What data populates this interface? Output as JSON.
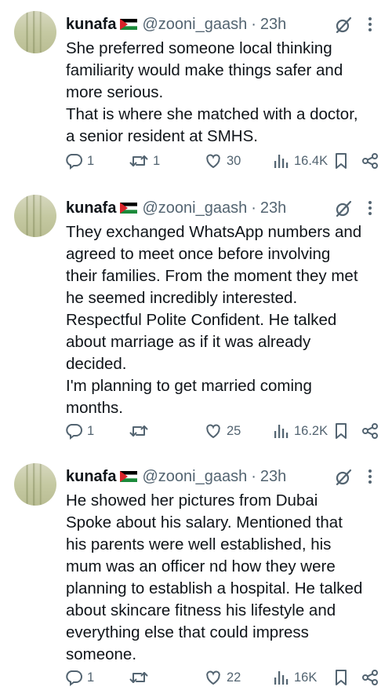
{
  "tweets": [
    {
      "author": {
        "name": "kunafa",
        "handle": "@zooni_gaash",
        "time": "23h"
      },
      "lines": [
        "She preferred someone local thinking",
        "familiarity would make things safer and",
        "more serious.",
        "That is where she matched with a doctor,",
        "a senior resident at SMHS."
      ],
      "stats": {
        "replies": "1",
        "retweets": "1",
        "likes": "30",
        "views": "16.4K"
      }
    },
    {
      "author": {
        "name": "kunafa",
        "handle": "@zooni_gaash",
        "time": "23h"
      },
      "lines": [
        "They exchanged WhatsApp numbers and",
        "agreed to meet once before involving",
        "their families. From the moment they met",
        "he seemed incredibly interested.",
        "Respectful Polite Confident. He talked",
        "about marriage as if it was already",
        "decided.",
        "I'm planning to get married coming",
        "months."
      ],
      "stats": {
        "replies": "1",
        "retweets": "",
        "likes": "25",
        "views": "16.2K"
      }
    },
    {
      "author": {
        "name": "kunafa",
        "handle": "@zooni_gaash",
        "time": "23h"
      },
      "lines": [
        "He showed her pictures from Dubai",
        "Spoke about his salary. Mentioned that",
        "his parents were well established, his",
        "mum was an officer nd how they were",
        "planning to establish a hospital. He talked",
        "about skincare fitness his lifestyle and",
        "everything else that could impress",
        "someone."
      ],
      "stats": {
        "replies": "1",
        "retweets": "",
        "likes": "22",
        "views": "16K"
      }
    }
  ],
  "ui": {
    "separator": "·",
    "icons": [
      "avatar",
      "palestine-flag-icon",
      "grok-icon",
      "more-icon",
      "reply-icon",
      "retweet-icon",
      "like-icon",
      "views-icon",
      "bookmark-icon",
      "share-icon"
    ],
    "colors": {
      "text": "#0f1419",
      "secondary": "#536471"
    }
  }
}
